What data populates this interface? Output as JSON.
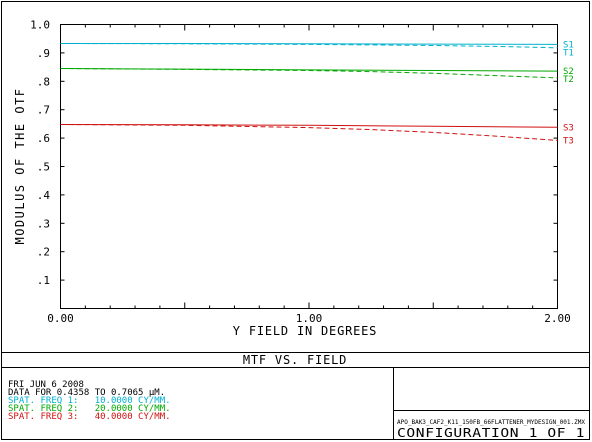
{
  "chart_data": {
    "type": "line",
    "title": "MTF VS. FIELD",
    "xlabel": "Y FIELD IN DEGREES",
    "ylabel": "MODULUS OF THE OTF",
    "xlim": [
      0.0,
      2.0
    ],
    "ylim": [
      0.0,
      1.0
    ],
    "xticks": [
      "0.00",
      "1.00",
      "2.00"
    ],
    "xtick_values": [
      0.0,
      1.0,
      2.0
    ],
    "yticks": [
      ".1",
      ".2",
      ".3",
      ".4",
      ".5",
      ".6",
      ".7",
      ".8",
      ".9",
      "1.0"
    ],
    "ytick_values": [
      0.1,
      0.2,
      0.3,
      0.4,
      0.5,
      0.6,
      0.7,
      0.8,
      0.9,
      1.0
    ],
    "grid": false,
    "series": [
      {
        "name": "S1",
        "style": "solid",
        "color": "#00b0d0",
        "x": [
          0.0,
          0.5,
          1.0,
          1.5,
          2.0
        ],
        "y": [
          0.933,
          0.933,
          0.932,
          0.931,
          0.93
        ]
      },
      {
        "name": "T1",
        "style": "dashed",
        "color": "#00b0d0",
        "x": [
          0.0,
          0.5,
          1.0,
          1.25,
          1.5,
          1.75,
          2.0
        ],
        "y": [
          0.933,
          0.932,
          0.93,
          0.928,
          0.926,
          0.923,
          0.918
        ]
      },
      {
        "name": "S2",
        "style": "solid",
        "color": "#00a800",
        "x": [
          0.0,
          0.5,
          1.0,
          1.5,
          2.0
        ],
        "y": [
          0.845,
          0.843,
          0.84,
          0.838,
          0.836
        ]
      },
      {
        "name": "T2",
        "style": "dashed",
        "color": "#00a800",
        "x": [
          0.0,
          0.5,
          1.0,
          1.25,
          1.5,
          1.75,
          2.0
        ],
        "y": [
          0.845,
          0.842,
          0.838,
          0.834,
          0.828,
          0.82,
          0.812
        ]
      },
      {
        "name": "S3",
        "style": "solid",
        "color": "#d01010",
        "x": [
          0.0,
          0.5,
          1.0,
          1.5,
          2.0
        ],
        "y": [
          0.648,
          0.647,
          0.645,
          0.642,
          0.638
        ]
      },
      {
        "name": "T3",
        "style": "dashed",
        "color": "#d01010",
        "x": [
          0.0,
          0.5,
          1.0,
          1.25,
          1.5,
          1.75,
          2.0
        ],
        "y": [
          0.648,
          0.645,
          0.637,
          0.63,
          0.62,
          0.607,
          0.592
        ]
      }
    ]
  },
  "info": {
    "date": "FRI JUN 6 2008",
    "data_range": "DATA FOR 0.4358 TO 0.7065 µM.",
    "freq1": "SPAT. FREQ 1:   10.0000 CY/MM.",
    "freq2": "SPAT. FREQ 2:   20.0000 CY/MM.",
    "freq3": "SPAT. FREQ 3:   40.0000 CY/MM.",
    "freq1_color": "#00b0d0",
    "freq2_color": "#00a800",
    "freq3_color": "#d01010"
  },
  "footer": {
    "filename": "APO_BAK3_CAF2_K11_150FB_66FLATTENER_MYDESIGN_001.ZMX",
    "configuration": "CONFIGURATION 1 OF 1"
  }
}
